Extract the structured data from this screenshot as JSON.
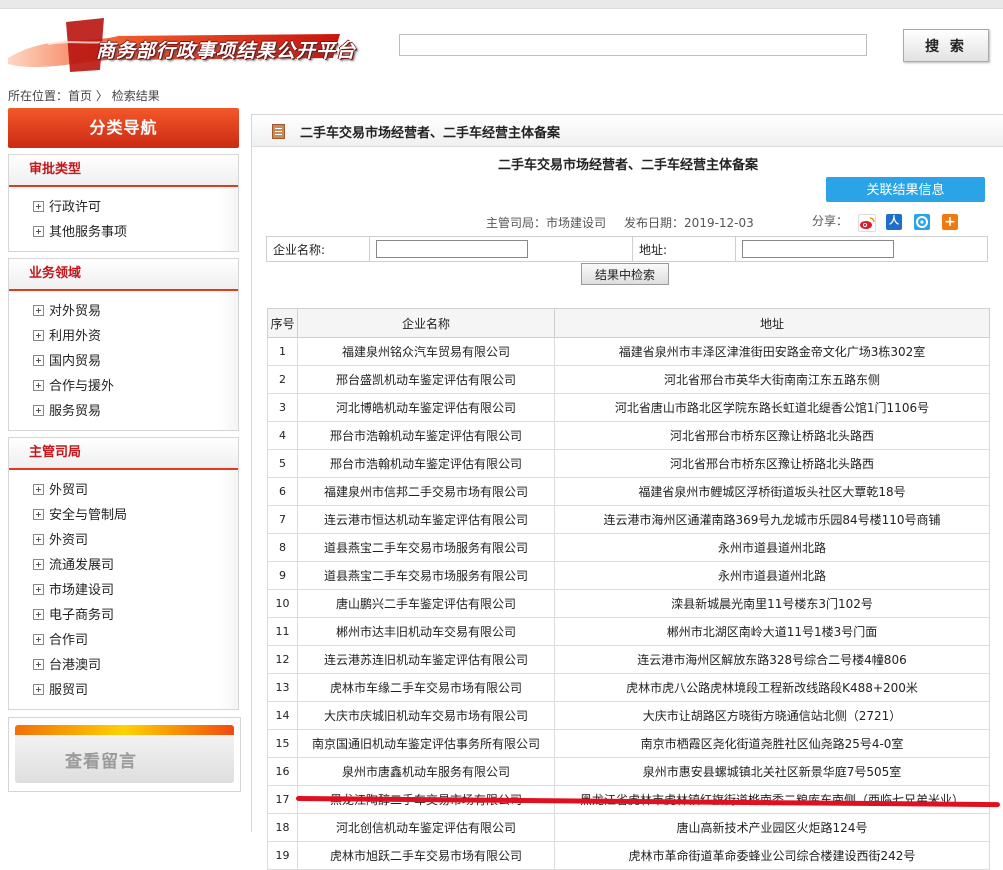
{
  "header": {
    "logo_text": "商务部行政事项结果公开平台",
    "search_placeholder": "",
    "search_button": "搜 索"
  },
  "breadcrumb": {
    "prefix": "所在位置：",
    "home": "首页",
    "separator": " 〉",
    "current": "检索结果"
  },
  "sidebar": {
    "header": "分类导航",
    "sections": [
      {
        "title": "审批类型",
        "items": [
          "行政许可",
          "其他服务事项"
        ]
      },
      {
        "title": "业务领域",
        "items": [
          "对外贸易",
          "利用外资",
          "国内贸易",
          "合作与援外",
          "服务贸易"
        ]
      },
      {
        "title": "主管司局",
        "items": [
          "外贸司",
          "安全与管制局",
          "外资司",
          "流通发展司",
          "市场建设司",
          "电子商务司",
          "合作司",
          "台港澳司",
          "服贸司"
        ]
      }
    ],
    "message_box": "查看留言"
  },
  "main": {
    "header_title": "二手车交易市场经营者、二手车经营主体备案",
    "page_title": "二手车交易市场经营者、二手车经营主体备案",
    "related_button": "关联结果信息",
    "dept_label": "主管司局：",
    "dept_value": "市场建设司",
    "date_label": "发布日期：",
    "date_value": "2019-12-03",
    "share_label": "分享：",
    "share_icons": [
      "weibo-icon",
      "renren-icon",
      "qzone-icon",
      "plus-icon"
    ],
    "filter": {
      "company_label": "企业名称:",
      "address_label": "地址:",
      "button": "结果中检索"
    },
    "table": {
      "headers": [
        "序号",
        "企业名称",
        "地址"
      ],
      "rows": [
        [
          "1",
          "福建泉州铭众汽车贸易有限公司",
          "福建省泉州市丰泽区津淮街田安路金帝文化广场3栋302室"
        ],
        [
          "2",
          "邢台盛凯机动车鉴定评估有限公司",
          "河北省邢台市英华大街南南江东五路东侧"
        ],
        [
          "3",
          "河北博皓机动车鉴定评估有限公司",
          "河北省唐山市路北区学院东路长虹道北缇香公馆1门1106号"
        ],
        [
          "4",
          "邢台市浩翰机动车鉴定评估有限公司",
          "河北省邢台市桥东区豫让桥路北头路西"
        ],
        [
          "5",
          "邢台市浩翰机动车鉴定评估有限公司",
          "河北省邢台市桥东区豫让桥路北头路西"
        ],
        [
          "6",
          "福建泉州市信邦二手交易市场有限公司",
          "福建省泉州市鲤城区浮桥街道坂头社区大覃乾18号"
        ],
        [
          "7",
          "连云港市恒达机动车鉴定评估有限公司",
          "连云港市海州区通灌南路369号九龙城市乐园84号楼110号商铺"
        ],
        [
          "8",
          "道县燕宝二手车交易市场服务有限公司",
          "永州市道县道州北路"
        ],
        [
          "9",
          "道县燕宝二手车交易市场服务有限公司",
          "永州市道县道州北路"
        ],
        [
          "10",
          "唐山鹏兴二手车鉴定评估有限公司",
          "滦县新城晨光南里11号楼东3门102号"
        ],
        [
          "11",
          "郴州市达丰旧机动车交易有限公司",
          "郴州市北湖区南岭大道11号1楼3号门面"
        ],
        [
          "12",
          "连云港苏连旧机动车鉴定评估有限公司",
          "连云港市海州区解放东路328号综合二号楼4幢806"
        ],
        [
          "13",
          "虎林市车缘二手车交易市场有限公司",
          "虎林市虎八公路虎林境段工程新改线路段K488+200米"
        ],
        [
          "14",
          "大庆市庆城旧机动车交易市场有限公司",
          "大庆市让胡路区方晓街方晓通信站北侧（2721）"
        ],
        [
          "15",
          "南京国通旧机动车鉴定评估事务所有限公司",
          "南京市栖霞区尧化街道尧胜社区仙尧路25号4-0室"
        ],
        [
          "16",
          "泉州市唐鑫机动车服务有限公司",
          "泉州市惠安县螺城镇北关社区新景华庭7号505室"
        ],
        [
          "17",
          "黑龙江陶醇二手车交易市场有限公司",
          "黑龙江省虎林市虎林镇红旗街道桦南委二粮库东南侧（西临七兄弟米业）"
        ],
        [
          "18",
          "河北创信机动车鉴定评估有限公司",
          "唐山高新技术产业园区火炬路124号"
        ],
        [
          "19",
          "虎林市旭跃二手车交易市场有限公司",
          "虎林市革命街道革命委蜂业公司综合楼建设西街242号"
        ]
      ]
    }
  },
  "colors": {
    "accent_red": "#c2171b",
    "nav_gradient_top": "#f3582a",
    "button_blue": "#2aa4e6",
    "annotation_red": "#e01020"
  }
}
